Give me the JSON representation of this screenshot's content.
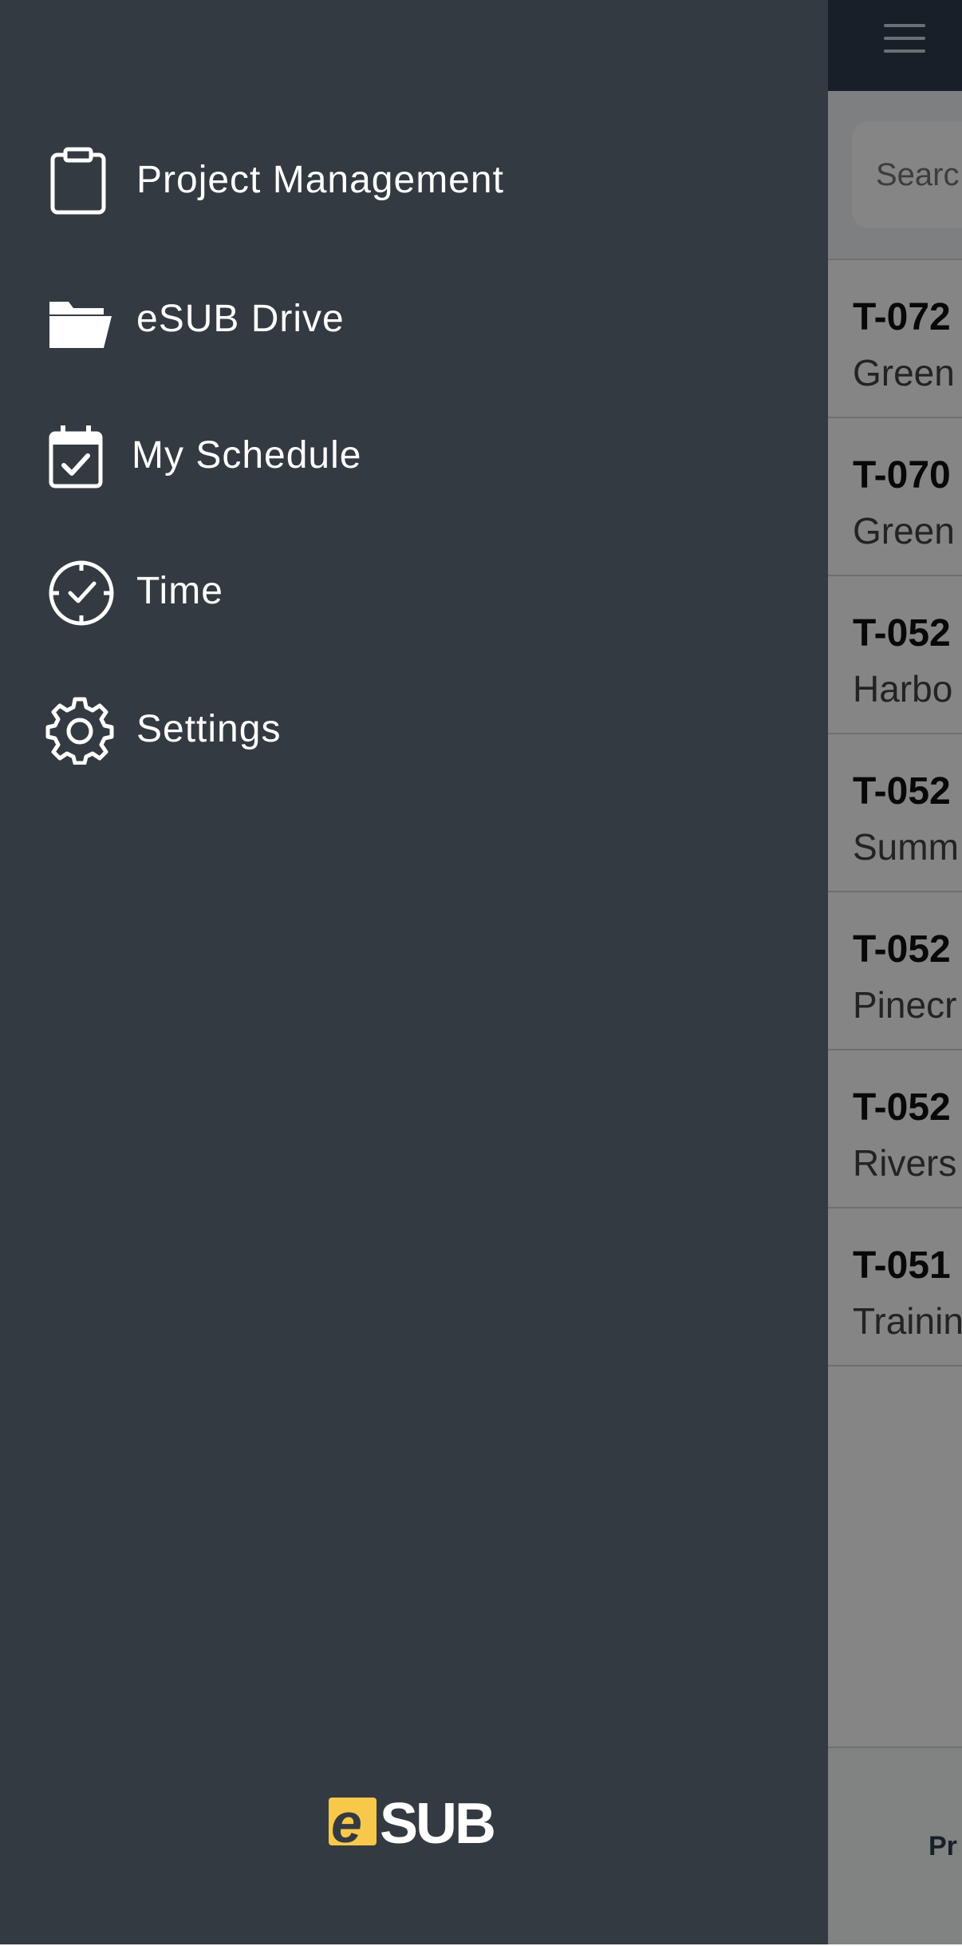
{
  "menu": {
    "items": [
      {
        "label": "Project Management",
        "icon": "clipboard-icon"
      },
      {
        "label": "eSUB Drive",
        "icon": "folder-open-icon"
      },
      {
        "label": "My Schedule",
        "icon": "calendar-check-icon"
      },
      {
        "label": "Time",
        "icon": "clock-check-icon"
      },
      {
        "label": "Settings",
        "icon": "gear-icon"
      }
    ]
  },
  "logo": {
    "e": "e",
    "text": "SUB"
  },
  "background": {
    "search": {
      "placeholder": "Searc"
    },
    "rows": [
      {
        "code": "T-072",
        "sub": "Green"
      },
      {
        "code": "T-070",
        "sub": "Green"
      },
      {
        "code": "T-052",
        "sub": "Harbo"
      },
      {
        "code": "T-052",
        "sub": "Summ"
      },
      {
        "code": "T-052",
        "sub": "Pinecr"
      },
      {
        "code": "T-052",
        "sub": "Rivers"
      },
      {
        "code": "T-051",
        "sub": "Trainin"
      }
    ],
    "bottom_label": "Pr"
  },
  "colors": {
    "drawer": "#343a41",
    "header": "#2c3e50",
    "logo_accent": "#f7c84a"
  }
}
